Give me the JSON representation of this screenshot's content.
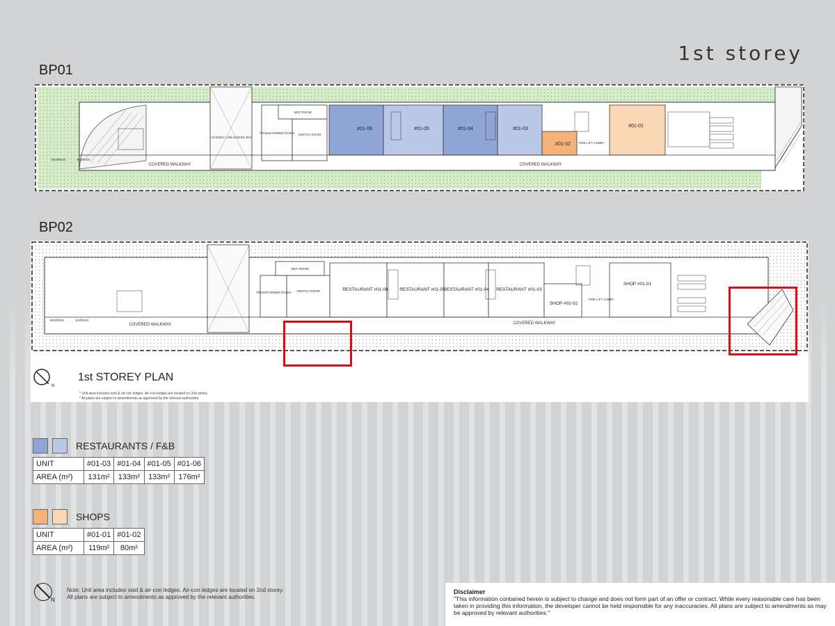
{
  "page": {
    "title": "1st storey"
  },
  "bp01": {
    "label": "BP01",
    "units": [
      {
        "id": "#01-06",
        "color": "#8fa5d6"
      },
      {
        "id": "#01-05",
        "color": "#bcc8e8"
      },
      {
        "id": "#01-04",
        "color": "#8fa5d6"
      },
      {
        "id": "#01-03",
        "color": "#bcc8e8"
      },
      {
        "id": "#01-02",
        "color": "#f4b27a"
      },
      {
        "id": "#01-01",
        "color": "#f9d6b4"
      }
    ],
    "rooms": {
      "walkway_left": "COVERED WALKWAY",
      "walkway_right": "COVERED WALKWAY",
      "loading": "LOADING / UNLOADING BAY",
      "transformer": "TRANSFORMER ROOM",
      "switch": "SWITCH ROOM",
      "mdf": "MDF ROOM",
      "lift": "FIRE LIFT LOBBY",
      "ingress": "INGRESS",
      "egress": "EGRESS"
    }
  },
  "bp02": {
    "label": "BP02",
    "units": [
      {
        "id": "RESTAURANT #01-06"
      },
      {
        "id": "RESTAURANT #01-05"
      },
      {
        "id": "RESTAURANT #01-04"
      },
      {
        "id": "RESTAURANT #01-03"
      },
      {
        "id": "SHOP #01-02"
      },
      {
        "id": "SHOP #01-01"
      }
    ],
    "rooms": {
      "walkway_left": "COVERED WALKWAY",
      "walkway_right": "COVERED WALKWAY",
      "transformer": "TRANSFORMER ROOM",
      "switch": "SWITCH ROOM",
      "mdf": "MDF ROOM",
      "lift": "FIRE LIFT LOBBY",
      "ingress": "INGRESS",
      "egress": "EGRESS"
    },
    "plan_title": "1st STOREY PLAN",
    "notes": [
      "* Unit area includes void & air-con ledges. Air-con ledges are located on 2nd storey",
      "* All plans are subject to amendments as approved by the relevant authorities"
    ]
  },
  "north": {
    "label": "N"
  },
  "legend": {
    "restaurants": {
      "title": "RESTAURANTS / F&B",
      "colors": [
        "#8fa5d6",
        "#bcc8e8"
      ],
      "header": [
        "UNIT",
        "#01-03",
        "#01-04",
        "#01-05",
        "#01-06"
      ],
      "area_label": "AREA (m²)",
      "areas": [
        "131m²",
        "133m²",
        "133m²",
        "176m²"
      ]
    },
    "shops": {
      "title": "SHOPS",
      "colors": [
        "#f4b27a",
        "#f9d6b4"
      ],
      "header": [
        "UNIT",
        "#01-01",
        "#01-02"
      ],
      "area_label": "AREA (m²)",
      "areas": [
        "119m²",
        "80m²"
      ]
    }
  },
  "footer_note": {
    "line1": "Note: Unit area includes void & air-con ledges. Air-con ledges are located on 2nd storey.",
    "line2": "All plans are subject to amendments as approved by the relevant authorities."
  },
  "disclaimer": {
    "heading": "Disclaimer",
    "text": "\"This information contained herein is subject to change and does not form part of an offer or contract. While every reasonable care has been taken in providing this information, the developer cannot be held responsible for any inaccuracies. All plans are subject to amendments as may be approved by relevant authorities.\""
  },
  "highlight_color": "#e30613"
}
